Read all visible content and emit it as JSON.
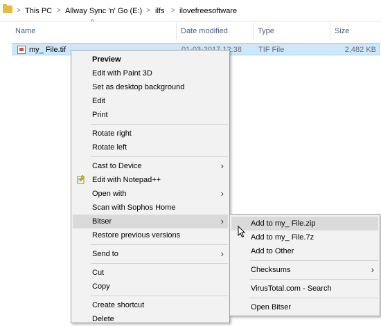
{
  "breadcrumb": {
    "items": [
      "This PC",
      "Allway Sync 'n' Go (E:)",
      "ilfs",
      "ilovefreesoftware"
    ]
  },
  "columns": {
    "name": "Name",
    "date": "Date modified",
    "type": "Type",
    "size": "Size"
  },
  "file": {
    "name": "my_ File.tif",
    "date": "01-03-2017 12:38",
    "type": "TIF File",
    "size": "2,482 KB"
  },
  "context_menu": {
    "preview": "Preview",
    "edit_paint3d": "Edit with Paint 3D",
    "set_desktop_bg": "Set as desktop background",
    "edit": "Edit",
    "print": "Print",
    "rotate_right": "Rotate right",
    "rotate_left": "Rotate left",
    "cast": "Cast to Device",
    "edit_notepadpp": "Edit with Notepad++",
    "open_with": "Open with",
    "scan_sophos": "Scan with Sophos Home",
    "bitser": "Bitser",
    "restore": "Restore previous versions",
    "send_to": "Send to",
    "cut": "Cut",
    "copy": "Copy",
    "create_shortcut": "Create shortcut",
    "delete": "Delete"
  },
  "submenu": {
    "add_zip": "Add to my_ File.zip",
    "add_7z": "Add to my_ File.7z",
    "add_other": "Add to Other",
    "checksums": "Checksums",
    "virustotal": "VirusTotal.com - Search",
    "open_bitser": "Open Bitser"
  },
  "colors": {
    "selection": "#cce8ff",
    "menu_bg": "#f2f2f2",
    "hover": "#dadada",
    "header_text": "#4c607a"
  }
}
